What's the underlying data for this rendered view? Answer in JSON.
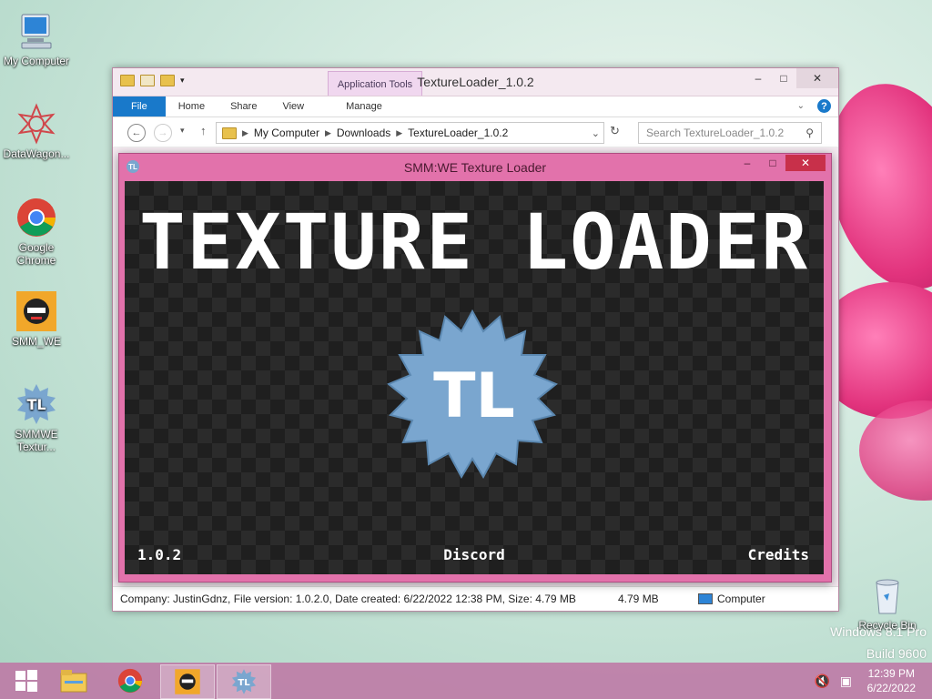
{
  "desktop": {
    "icons": [
      {
        "label": "My Computer"
      },
      {
        "label": "DataWagon..."
      },
      {
        "label": "Google Chrome"
      },
      {
        "label": "SMM_WE"
      },
      {
        "label": "SMMWE Textur..."
      },
      {
        "label": "Recycle Bin"
      }
    ],
    "watermark": {
      "line1": "Windows 8.1 Pro",
      "line2": "Build 9600"
    }
  },
  "explorer": {
    "title": "TextureLoader_1.0.2",
    "context_tab": "Application Tools",
    "ribbon_tabs": [
      "File",
      "Home",
      "Share",
      "View",
      "Manage"
    ],
    "address": {
      "crumbs": [
        "My Computer",
        "Downloads",
        "TextureLoader_1.0.2"
      ]
    },
    "search_placeholder": "Search TextureLoader_1.0.2",
    "status": {
      "details": "Company: JustinGdnz, File version: 1.0.2.0, Date created: 6/22/2022 12:38 PM, Size: 4.79 MB",
      "size": "4.79 MB",
      "location": "Computer"
    },
    "window_buttons": {
      "min": "–",
      "max": "□",
      "close": "✕"
    }
  },
  "texture_loader": {
    "title": "SMM:WE Texture Loader",
    "app_icon_text": "TL",
    "heading": "TEXTURE LOADER",
    "badge_text": "TL",
    "version": "1.0.2",
    "discord": "Discord",
    "credits": "Credits",
    "window_buttons": {
      "min": "–",
      "max": "□",
      "close": "✕"
    }
  },
  "taskbar": {
    "time": "12:39 PM",
    "date": "6/22/2022",
    "pinned": [
      "start-button",
      "file-explorer",
      "google-chrome",
      "smm-we",
      "texture-loader"
    ]
  },
  "colors": {
    "accent": "#1979ca",
    "tl_frame": "#e272ab",
    "badge": "#7aa6cf"
  }
}
